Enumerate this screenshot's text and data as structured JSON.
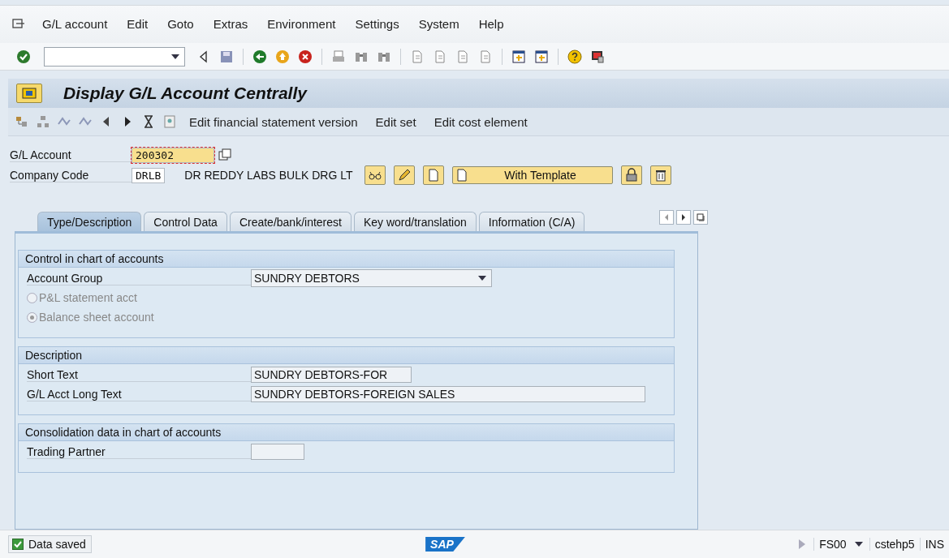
{
  "menu": [
    "G/L account",
    "Edit",
    "Goto",
    "Extras",
    "Environment",
    "Settings",
    "System",
    "Help"
  ],
  "title": "Display G/L Account Centrally",
  "app_toolbar": [
    "Edit financial statement version",
    "Edit set",
    "Edit cost element"
  ],
  "header": {
    "gl_account_label": "G/L Account",
    "gl_account": "200302",
    "company_code_label": "Company Code",
    "company_code": "DRLB",
    "company_name": "DR REDDY LABS BULK DRG LT",
    "template_button": "With Template"
  },
  "tabs": [
    {
      "label": "Type/Description",
      "selected": true
    },
    {
      "label": "Control Data",
      "selected": false
    },
    {
      "label": "Create/bank/interest",
      "selected": false
    },
    {
      "label": "Key word/translation",
      "selected": false
    },
    {
      "label": "Information (C/A)",
      "selected": false
    }
  ],
  "groups": [
    {
      "title": "Control in chart of accounts",
      "rows": [
        {
          "kind": "dropdown",
          "label": "Account Group",
          "value": "SUNDRY DEBTORS"
        },
        {
          "kind": "radio",
          "label": "P&L statement acct",
          "selected": false,
          "disabled": true
        },
        {
          "kind": "radio",
          "label": "Balance sheet account",
          "selected": true,
          "disabled": true
        }
      ]
    },
    {
      "title": "Description",
      "rows": [
        {
          "kind": "field",
          "label": "Short Text",
          "value": "SUNDRY DEBTORS-FOR"
        },
        {
          "kind": "longfield",
          "label": "G/L Acct Long Text",
          "value": "SUNDRY DEBTORS-FOREIGN  SALES"
        }
      ]
    },
    {
      "title": "Consolidation data in chart of accounts",
      "rows": [
        {
          "kind": "shortfield",
          "label": "Trading Partner"
        }
      ]
    }
  ],
  "status": {
    "message": "Data saved",
    "logo": "SAP",
    "transaction": "FS00",
    "server": "cstehp5",
    "mode": "INS"
  }
}
